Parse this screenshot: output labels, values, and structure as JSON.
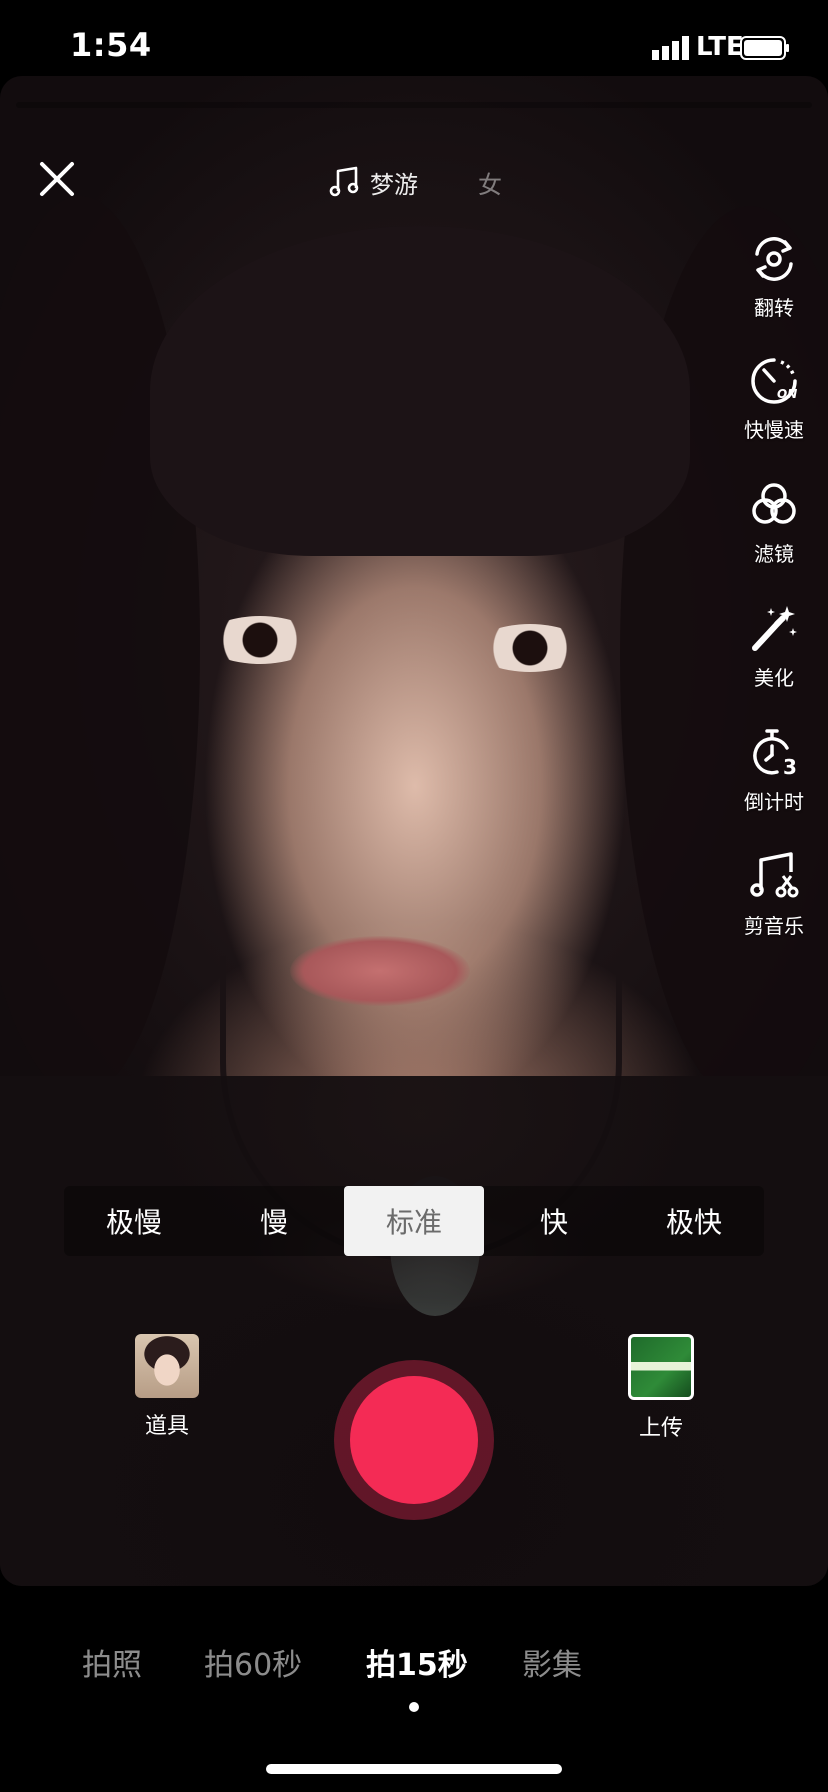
{
  "status_bar": {
    "time": "1:54",
    "network": "LTE"
  },
  "top": {
    "music_text": "梦游",
    "music_next": "女"
  },
  "right_toolbar": [
    {
      "label": "翻转",
      "icon": "flip-camera-icon"
    },
    {
      "label": "快慢速",
      "icon": "speed-icon"
    },
    {
      "label": "滤镜",
      "icon": "filter-icon"
    },
    {
      "label": "美化",
      "icon": "beauty-wand-icon"
    },
    {
      "label": "倒计时",
      "icon": "countdown-timer-icon"
    },
    {
      "label": "剪音乐",
      "icon": "cut-music-icon"
    }
  ],
  "speed_options": [
    "极慢",
    "慢",
    "标准",
    "快",
    "极快"
  ],
  "speed_selected": "标准",
  "bottom_controls": {
    "props_label": "道具",
    "upload_label": "上传"
  },
  "mode_tabs": [
    "拍照",
    "拍60秒",
    "拍15秒",
    "影集"
  ],
  "mode_selected": "拍15秒",
  "colors": {
    "record": "#f42b55",
    "speed_active_bg": "#f2f2f2"
  }
}
